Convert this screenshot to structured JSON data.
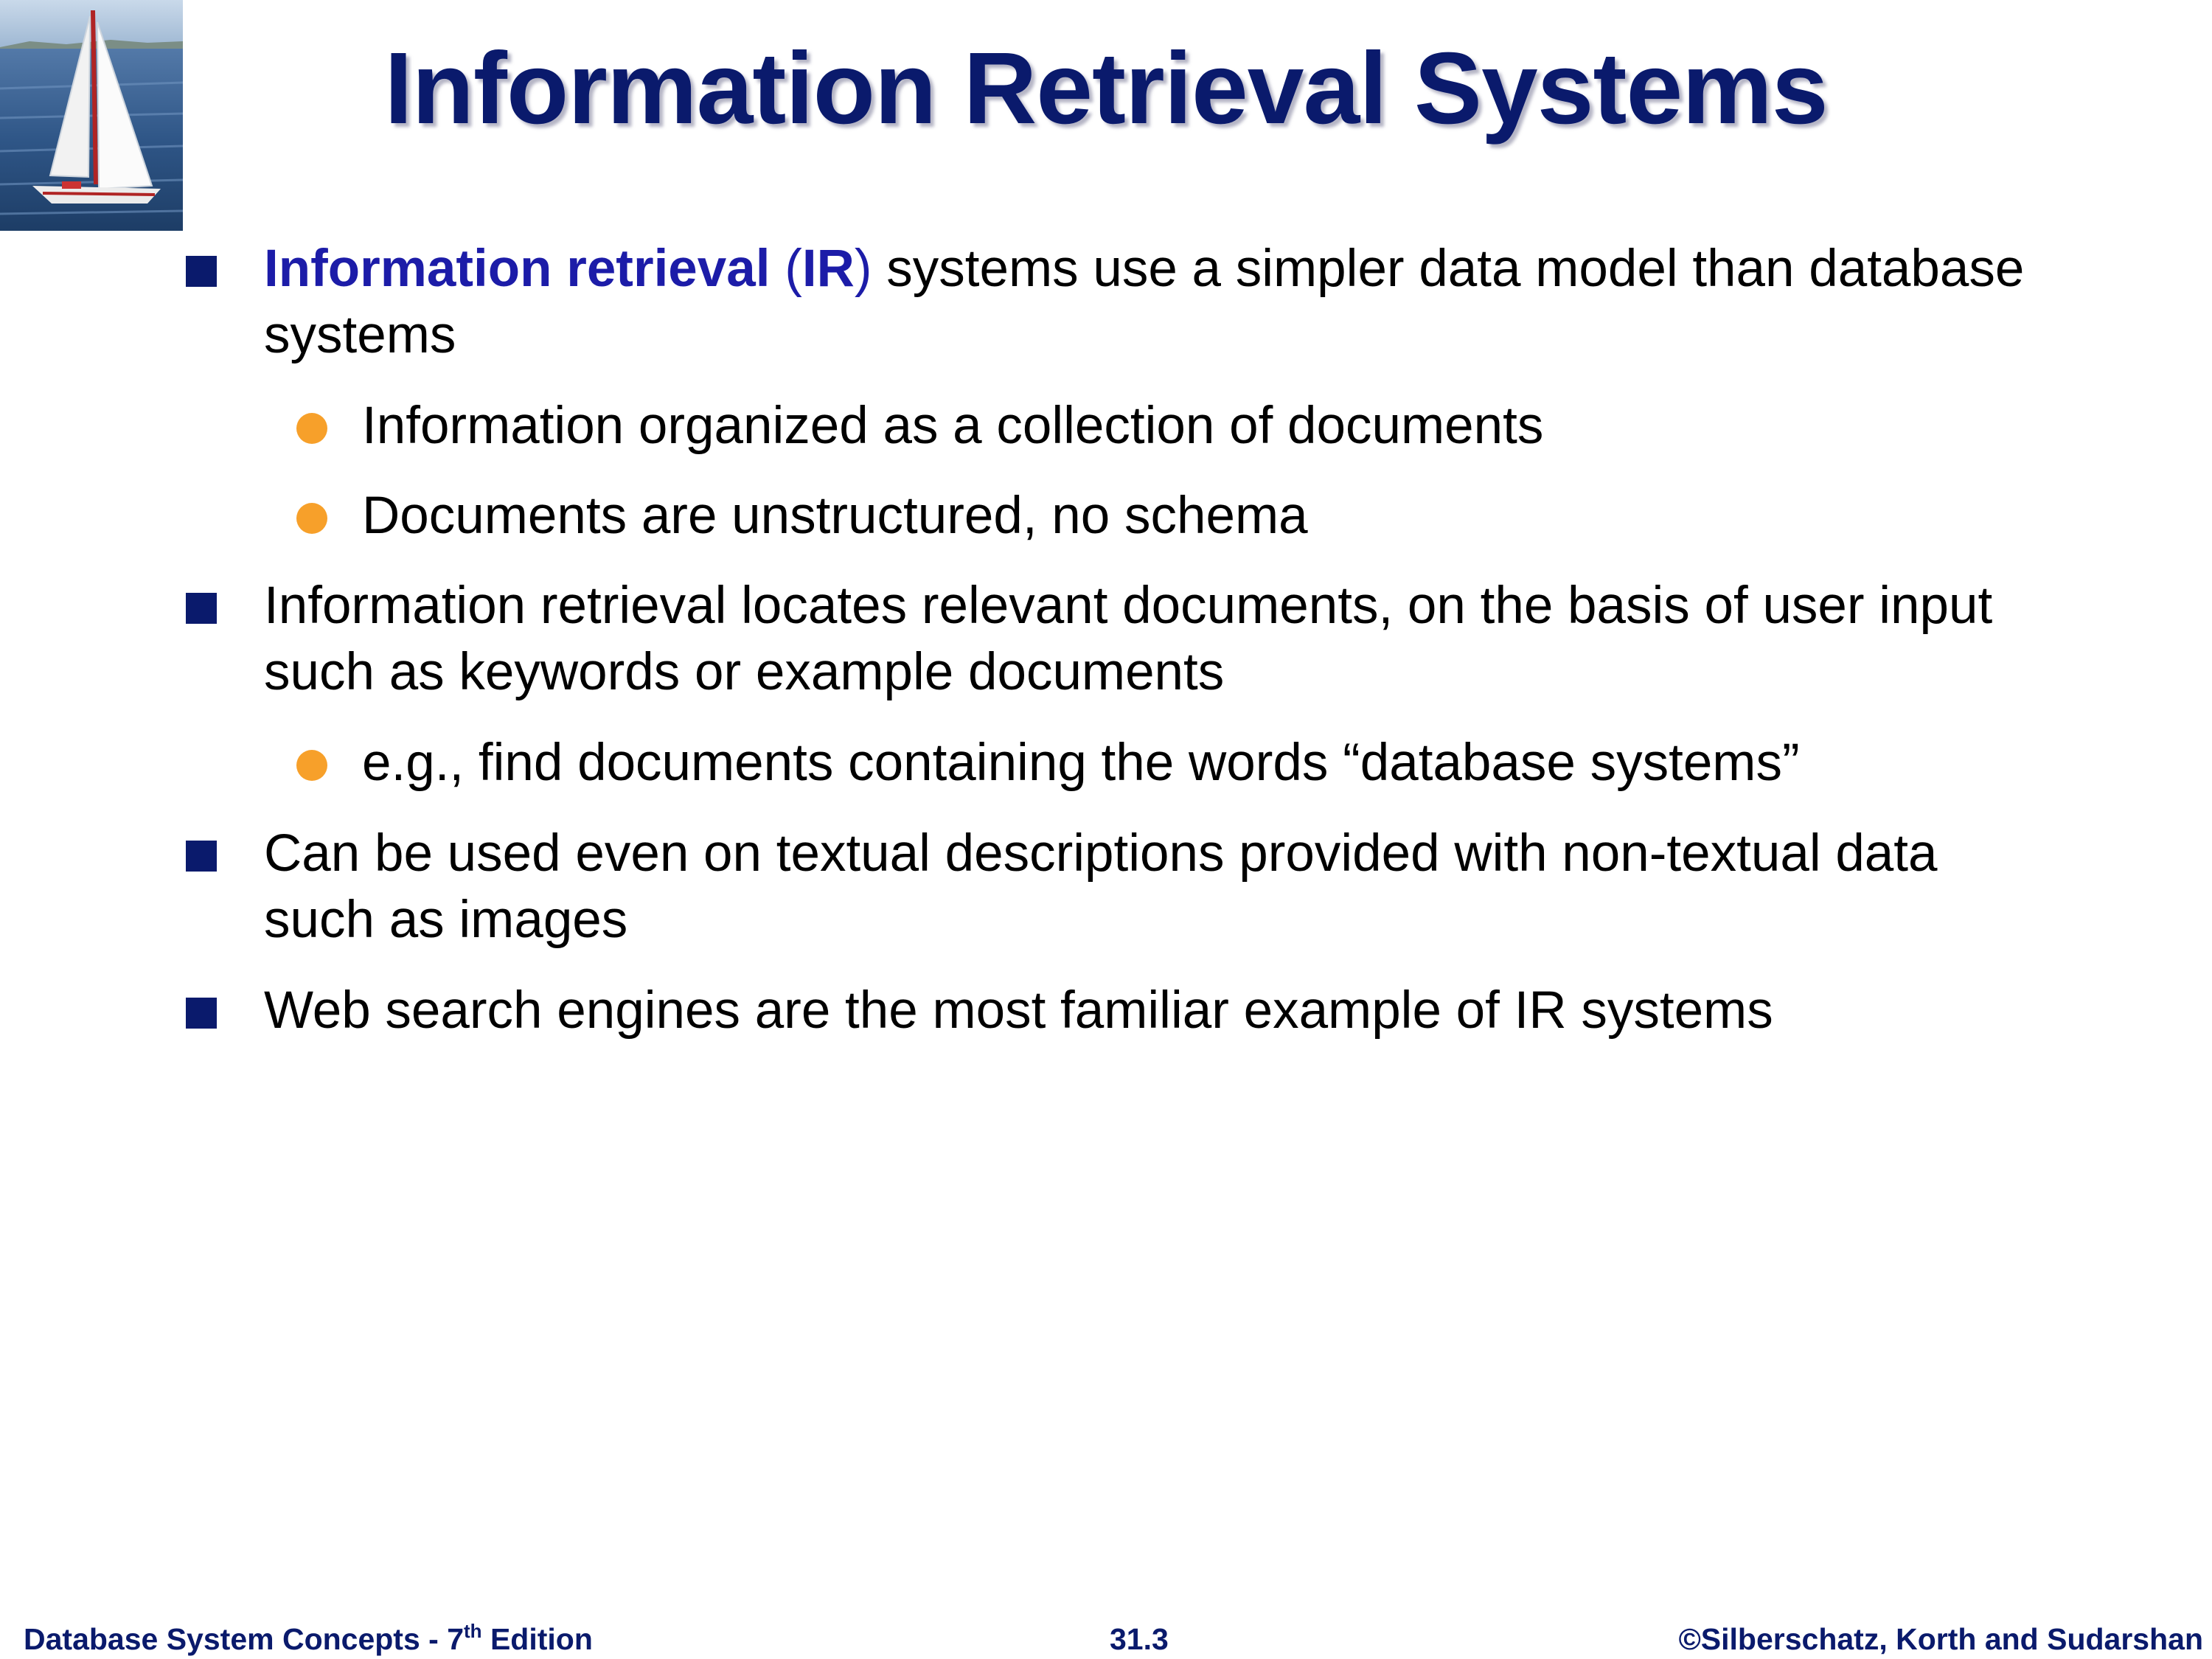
{
  "slide": {
    "title": "Information Retrieval Systems",
    "bullets": [
      {
        "term": "Information retrieval",
        "paren_open": "(",
        "abbr": "IR",
        "paren_close": ")",
        "rest": " systems use a simpler data model than database systems",
        "sub": [
          "Information organized as a collection of documents",
          "Documents are unstructured, no schema"
        ]
      },
      {
        "text": "Information retrieval locates relevant documents, on the basis of user input such as keywords or example documents",
        "sub": [
          "e.g., find documents containing the words “database systems”"
        ]
      },
      {
        "text": "Can be used even on textual descriptions provided with non-textual data such as images"
      },
      {
        "text": "Web search engines are the most familiar example of IR systems"
      }
    ]
  },
  "footer": {
    "book_pre": "Database System Concepts - 7",
    "book_sup": "th",
    "book_post": " Edition",
    "page": "31.3",
    "copyright": "©Silberschatz, Korth and Sudarshan"
  },
  "colors": {
    "title": "#0a1a6c",
    "term": "#1c1ca8",
    "square_bullet": "#0a1a6c",
    "round_bullet": "#f7a02a",
    "footer": "#0a1a6c"
  },
  "icons": {
    "logo": "sailboat-image",
    "level1_bullet": "square-bullet-icon",
    "level2_bullet": "round-bullet-icon"
  }
}
